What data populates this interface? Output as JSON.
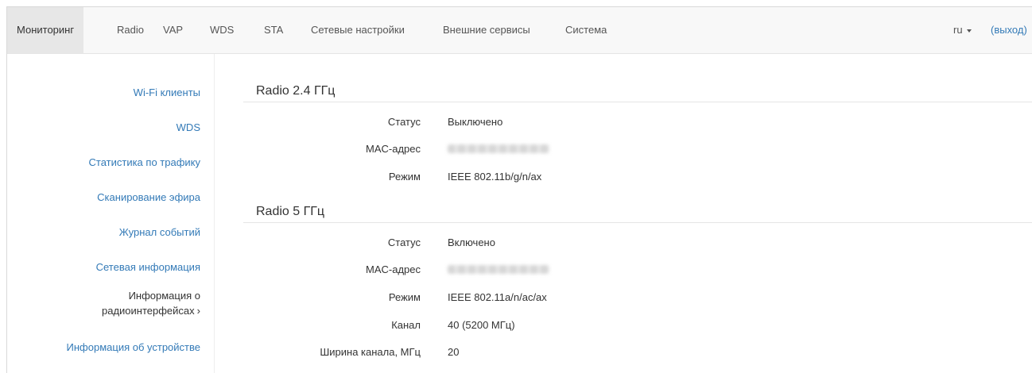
{
  "nav": {
    "items": [
      {
        "label": "Мониторинг",
        "active": true
      },
      {
        "label": "Radio"
      },
      {
        "label": "VAP"
      },
      {
        "label": "WDS"
      },
      {
        "label": "STA"
      },
      {
        "label": "Сетевые настройки"
      },
      {
        "label": "Внешние сервисы"
      },
      {
        "label": "Система"
      }
    ],
    "lang": "ru",
    "logout": "(выход)"
  },
  "sidebar": {
    "items": [
      {
        "label": "Wi-Fi клиенты"
      },
      {
        "label": "WDS"
      },
      {
        "label": "Статистика по трафику"
      },
      {
        "label": "Сканирование эфира"
      },
      {
        "label": "Журнал событий"
      },
      {
        "label": "Сетевая информация"
      },
      {
        "label_line1": "Информация о",
        "label_line2": "радиоинтерфейсах",
        "active": true
      },
      {
        "label": "Информация об устройстве"
      }
    ]
  },
  "radio24": {
    "title": "Radio 2.4 ГГц",
    "rows": [
      {
        "label": "Статус",
        "value": "Выключено"
      },
      {
        "label": "MAC-адрес",
        "value": ""
      },
      {
        "label": "Режим",
        "value": "IEEE 802.11b/g/n/ax"
      }
    ]
  },
  "radio5": {
    "title": "Radio 5 ГГц",
    "rows": [
      {
        "label": "Статус",
        "value": "Включено"
      },
      {
        "label": "MAC-адрес",
        "value": ""
      },
      {
        "label": "Режим",
        "value": "IEEE 802.11a/n/ac/ax"
      },
      {
        "label": "Канал",
        "value": "40 (5200 МГц)"
      },
      {
        "label": "Ширина канала, МГц",
        "value": "20"
      }
    ]
  },
  "colors": {
    "link": "#337ab7",
    "nav_bg": "#f8f8f8",
    "nav_active_bg": "#e7e7e7"
  }
}
